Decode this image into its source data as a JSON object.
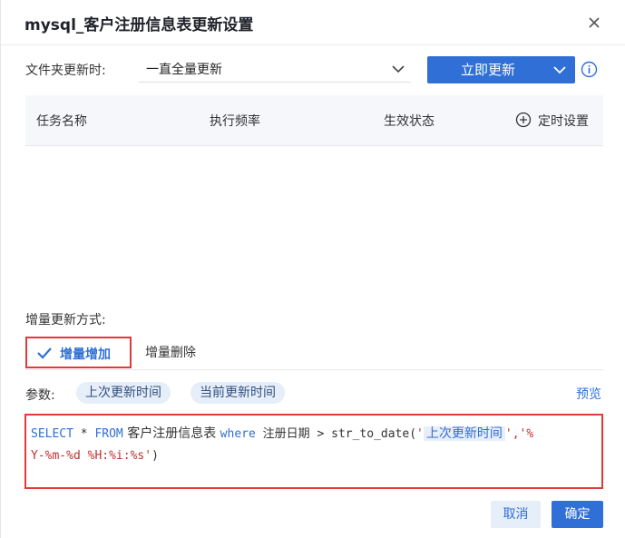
{
  "dialog": {
    "title": "mysql_客户注册信息表更新设置"
  },
  "folder_update": {
    "label": "文件夹更新时:",
    "select_value": "一直全量更新",
    "update_now_label": "立即更新"
  },
  "schedule_table": {
    "columns": [
      "任务名称",
      "执行频率",
      "生效状态"
    ],
    "add_label": "定时设置"
  },
  "incremental": {
    "label": "增量更新方式:",
    "tabs": [
      "增量增加",
      "增量删除"
    ]
  },
  "params": {
    "label": "参数:",
    "chips": [
      "上次更新时间",
      "当前更新时间"
    ],
    "preview_label": "预览"
  },
  "sql": {
    "select_kw": "SELECT",
    "star": " * ",
    "from_kw": "FROM",
    "table": " 客户注册信息表 ",
    "where_kw": "where",
    "condition": " 注册日期 > str_to_date(",
    "quote_open": "'",
    "param": "上次更新时间",
    "quote_close": "',",
    "format_part1": "'%",
    "format_part2": "Y-%m-%d %H:%i:%s'",
    "close_paren": ")"
  },
  "footer": {
    "cancel_label": "取消",
    "confirm_label": "确定"
  },
  "colors": {
    "primary": "#2f6fd6",
    "highlight_border": "#e03b3b"
  }
}
